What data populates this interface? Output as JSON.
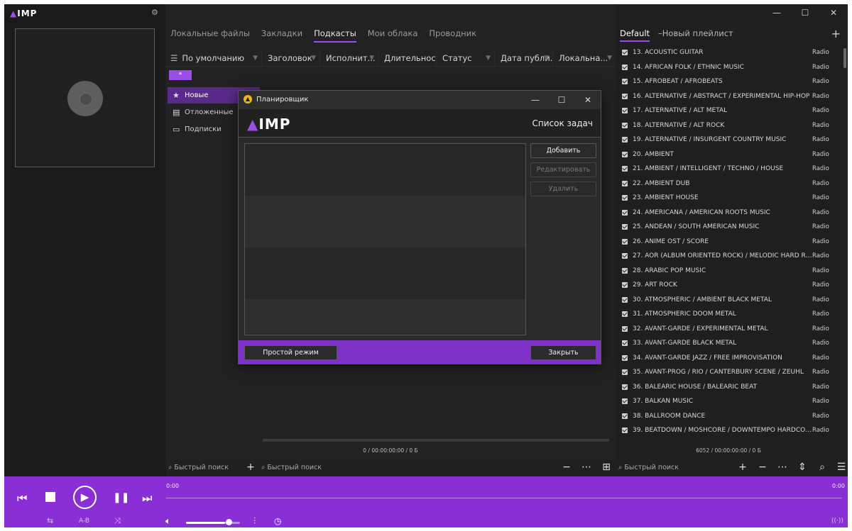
{
  "app": {
    "logo_text": "IMP",
    "logo_mark": "▲"
  },
  "middle": {
    "tabs": [
      {
        "label": "Локальные файлы"
      },
      {
        "label": "Закладки"
      },
      {
        "label": "Подкасты",
        "active": true
      },
      {
        "label": "Мои облака"
      },
      {
        "label": "Проводник"
      }
    ],
    "columns": [
      {
        "label": "По умолчанию"
      },
      {
        "label": "Заголовок"
      },
      {
        "label": "Исполнит..."
      },
      {
        "label": "Длительность"
      },
      {
        "label": "Статус"
      },
      {
        "label": "Дата публи..."
      },
      {
        "label": "Локальна..."
      }
    ],
    "chip_label": "*",
    "podcast_nav": [
      {
        "label": "Новые",
        "icon": "star-icon",
        "active": true
      },
      {
        "label": "Отложенные",
        "icon": "calendar-icon"
      },
      {
        "label": "Подписки",
        "icon": "folder-icon"
      }
    ],
    "status": "0 / 00:00:00:00 / 0 Б"
  },
  "playlist": {
    "tabs": [
      {
        "label": "Default",
        "active": true
      },
      {
        "label": "Новый плейлист"
      }
    ],
    "items": [
      {
        "title": "13. ACOUSTIC GUITAR",
        "source": "Radio"
      },
      {
        "title": "14. AFRICAN FOLK / ETHNIC MUSIC",
        "source": "Radio"
      },
      {
        "title": "15. AFROBEAT / AFROBEATS",
        "source": "Radio"
      },
      {
        "title": "16. ALTERNATIVE / ABSTRACT / EXPERIMENTAL HIP-HOP",
        "source": "Radio"
      },
      {
        "title": "17. ALTERNATIVE / ALT METAL",
        "source": "Radio"
      },
      {
        "title": "18. ALTERNATIVE / ALT ROCK",
        "source": "Radio"
      },
      {
        "title": "19. ALTERNATIVE / INSURGENT COUNTRY MUSIC",
        "source": "Radio"
      },
      {
        "title": "20. AMBIENT",
        "source": "Radio"
      },
      {
        "title": "21. AMBIENT / INTELLIGENT / TECHNO / HOUSE",
        "source": "Radio"
      },
      {
        "title": "22. AMBIENT DUB",
        "source": "Radio"
      },
      {
        "title": "23. AMBIENT HOUSE",
        "source": "Radio"
      },
      {
        "title": "24. AMERICANA / AMERICAN ROOTS MUSIC",
        "source": "Radio"
      },
      {
        "title": "25. ANDEAN / SOUTH AMERICAN MUSIC",
        "source": "Radio"
      },
      {
        "title": "26. ANIME OST / SCORE",
        "source": "Radio"
      },
      {
        "title": "27. AOR (ALBUM ORIENTED ROCK) / MELODIC HARD ROCK",
        "source": "Radio"
      },
      {
        "title": "28. ARABIC POP MUSIC",
        "source": "Radio"
      },
      {
        "title": "29. ART ROCK",
        "source": "Radio"
      },
      {
        "title": "30. ATMOSPHERIC / AMBIENT BLACK METAL",
        "source": "Radio"
      },
      {
        "title": "31. ATMOSPHERIC DOOM METAL",
        "source": "Radio"
      },
      {
        "title": "32. AVANT-GARDE / EXPERIMENTAL METAL",
        "source": "Radio"
      },
      {
        "title": "33. AVANT-GARDE BLACK METAL",
        "source": "Radio"
      },
      {
        "title": "34. AVANT-GARDE JAZZ / FREE IMPROVISATION",
        "source": "Radio"
      },
      {
        "title": "35. AVANT-PROG / RIO / CANTERBURY SCENE / ZEUHL",
        "source": "Radio"
      },
      {
        "title": "36. BALEARIC HOUSE / BALEARIC BEAT",
        "source": "Radio"
      },
      {
        "title": "37. BALKAN MUSIC",
        "source": "Radio"
      },
      {
        "title": "38. BALLROOM DANCE",
        "source": "Radio"
      },
      {
        "title": "39. BEATDOWN / MOSHCORE / DOWNTEMPO HARDCORE...",
        "source": "Radio"
      }
    ],
    "status": "6052 / 00:00:00:00 / 0 Б"
  },
  "search": {
    "left": "Быстрый поиск",
    "middle": "Быстрый поиск",
    "right": "Быстрый поиск"
  },
  "player": {
    "time_current": "0:00",
    "time_total": "0:00",
    "ab_label": "A-B",
    "volume": 0.73
  },
  "dialog": {
    "title": "Планировщик",
    "heading": "Список задач",
    "add_label": "Добавить",
    "edit_label": "Редактировать",
    "delete_label": "Удалить",
    "simple_mode_label": "Простой режим",
    "close_label": "Закрыть"
  },
  "colors": {
    "accent": "#8a2fd6",
    "dialog_footer": "#7d31c7",
    "background": "#202020"
  }
}
